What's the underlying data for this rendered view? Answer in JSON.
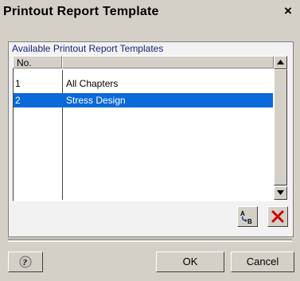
{
  "window": {
    "title": "Printout Report Template",
    "close_glyph": "×"
  },
  "group": {
    "label": "Available Printout Report Templates"
  },
  "table": {
    "columns": [
      "No.",
      ""
    ],
    "rows": [
      {
        "no": "1",
        "name": "All Chapters",
        "selected": false
      },
      {
        "no": "2",
        "name": "Stress Design",
        "selected": true
      }
    ]
  },
  "list_actions": {
    "rename_icon": "rename-ab-icon",
    "delete_icon": "delete-x-icon"
  },
  "footer": {
    "help_icon": "help-icon",
    "ok_label": "OK",
    "cancel_label": "Cancel"
  },
  "colors": {
    "selection": "#0a6ad9",
    "group_label": "#1a1f7a",
    "delete": "#cc0000"
  }
}
